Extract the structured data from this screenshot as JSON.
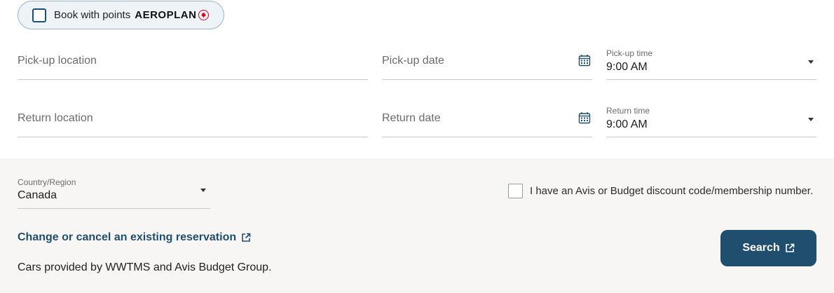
{
  "points": {
    "label": "Book with points",
    "brand": "AEROPLAN",
    "checked": false
  },
  "pickup_location": {
    "placeholder": "Pick-up location"
  },
  "pickup_date": {
    "placeholder": "Pick-up date"
  },
  "pickup_time": {
    "label": "Pick-up time",
    "value": "9:00 AM"
  },
  "return_location": {
    "placeholder": "Return location"
  },
  "return_date": {
    "placeholder": "Return date"
  },
  "return_time": {
    "label": "Return time",
    "value": "9:00 AM"
  },
  "country": {
    "label": "Country/Region",
    "value": "Canada"
  },
  "discount": {
    "label": "I have an Avis or Budget discount code/membership number.",
    "checked": false
  },
  "change_link": "Change or cancel an existing reservation",
  "provided_by": "Cars provided by WWTMS and Avis Budget Group.",
  "search_button": "Search",
  "colors": {
    "primary": "#1f4e6e",
    "aeroplan_red": "#d6001c",
    "bottom_panel": "#f7f6f4"
  },
  "icons": [
    "checkbox-icon",
    "maple-leaf-icon",
    "calendar-icon",
    "chevron-down-icon",
    "external-link-icon"
  ]
}
